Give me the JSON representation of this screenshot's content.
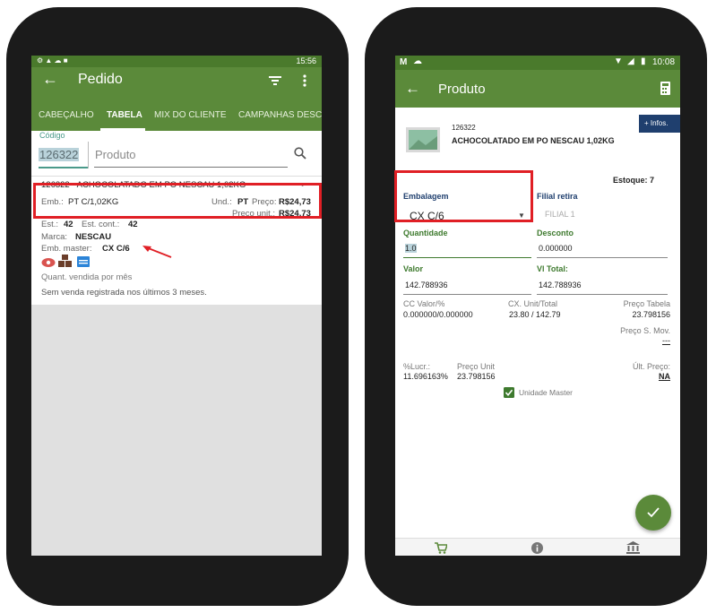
{
  "labels": {
    "one": "1",
    "two": "2"
  },
  "phone1": {
    "status": {
      "time": "15:56"
    },
    "title": "Pedido",
    "tabs": [
      "CABEÇALHO",
      "TABELA",
      "MIX DO CLIENTE",
      "CAMPANHAS DESCO"
    ],
    "codigo_label": "Código",
    "codigo_value": "126322",
    "produto_placeholder": "Produto",
    "item": {
      "title": "126322 - ACHOCOLATADO EM PO NESCAU 1,02KG",
      "emb_label": "Emb.:",
      "emb_value": "PT C/1,02KG",
      "und_label": "Und.:",
      "und_value": "PT",
      "preco_label": "Preço:",
      "preco_value": "R$24,73",
      "preco_unit_label": "Preço unit.:",
      "preco_unit_value": "R$24,73",
      "est_label": "Est.:",
      "est_value": "42",
      "est_cont_label": "Est. cont.:",
      "est_cont_value": "42",
      "marca_label": "Marca:",
      "marca_value": "NESCAU",
      "emb_master_label": "Emb. master:",
      "emb_master_value": "CX C/6",
      "quant_label": "Quant. vendida por mês",
      "sem_venda": "Sem venda registrada nos últimos 3 meses."
    }
  },
  "phone2": {
    "status": {
      "time": "10:08"
    },
    "title": "Produto",
    "infos_button": "+ Infos.",
    "product_code": "126322",
    "product_name": "ACHOCOLATADO EM PO NESCAU 1,02KG",
    "estoque": "Estoque: 7",
    "embalagem_label": "Embalagem",
    "embalagem_value": "CX C/6",
    "filial_label": "Filial retira",
    "filial_value": "FILIAL 1",
    "quantidade_label": "Quantidade",
    "quantidade_value": "1.0",
    "desconto_label": "Desconto",
    "desconto_value": "0.000000",
    "valor_label": "Valor",
    "valor_value": "142.788936",
    "vltotal_label": "Vl Total:",
    "vltotal_value": "142.788936",
    "cc_label": "CC Valor/%",
    "cc_value": "0.000000/0.000000",
    "cx_label": "CX. Unit/Total",
    "cx_value": "23.80 / 142.79",
    "preco_tabela_label": "Preço Tabela",
    "preco_tabela_value": "23.798156",
    "preco_smov_label": "Preço S. Mov.",
    "preco_smov_value": "---",
    "lucr_label": "%Lucr.:",
    "lucr_value": "11.696163%",
    "preco_unit_label": "Preço Unit",
    "preco_unit_value": "23.798156",
    "ult_preco_label": "Últ. Preço:",
    "ult_preco_value": "NA",
    "unidade_master_label": "Unidade Master"
  },
  "colors": {
    "green": "#5b8a3a",
    "red": "#e01f25",
    "dark_green_text": "#3e7a2e"
  }
}
